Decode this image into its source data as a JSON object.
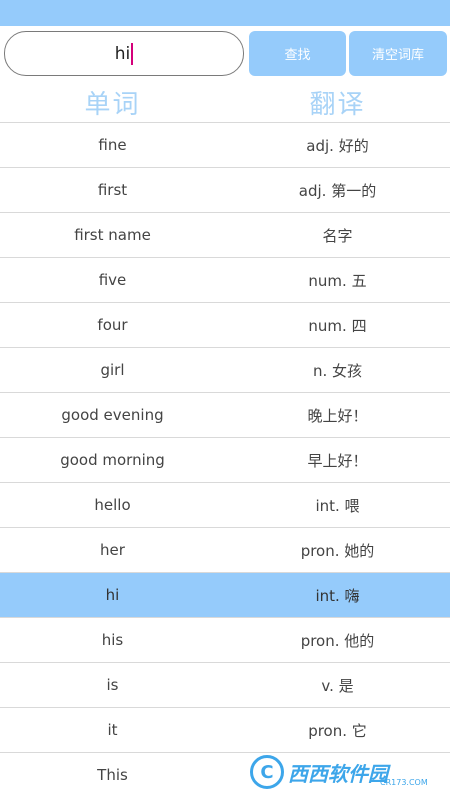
{
  "search": {
    "value": "hi",
    "search_button": "查找",
    "clear_button": "清空词库"
  },
  "header": {
    "word": "单词",
    "translation": "翻译"
  },
  "rows": [
    {
      "word": "fine",
      "translation": "adj. 好的"
    },
    {
      "word": "first",
      "translation": "adj. 第一的"
    },
    {
      "word": "first name",
      "translation": "名字"
    },
    {
      "word": "five",
      "translation": "num. 五"
    },
    {
      "word": "four",
      "translation": "num. 四"
    },
    {
      "word": "girl",
      "translation": "n. 女孩"
    },
    {
      "word": "good evening",
      "translation": "晚上好！"
    },
    {
      "word": "good morning",
      "translation": "早上好！"
    },
    {
      "word": "hello",
      "translation": "int. 喂"
    },
    {
      "word": "her",
      "translation": "pron. 她的"
    },
    {
      "word": "hi",
      "translation": "int. 嗨",
      "selected": true
    },
    {
      "word": "his",
      "translation": "pron. 他的"
    },
    {
      "word": "is",
      "translation": "v. 是"
    },
    {
      "word": "it",
      "translation": "pron. 它"
    },
    {
      "word": "This",
      "translation": ""
    }
  ],
  "watermark": {
    "text": "西西软件园",
    "sub": "CR173.COM"
  },
  "colors": {
    "accent": "#95cbfb",
    "header_text": "#a8d3f7",
    "caret": "#d4007a"
  }
}
